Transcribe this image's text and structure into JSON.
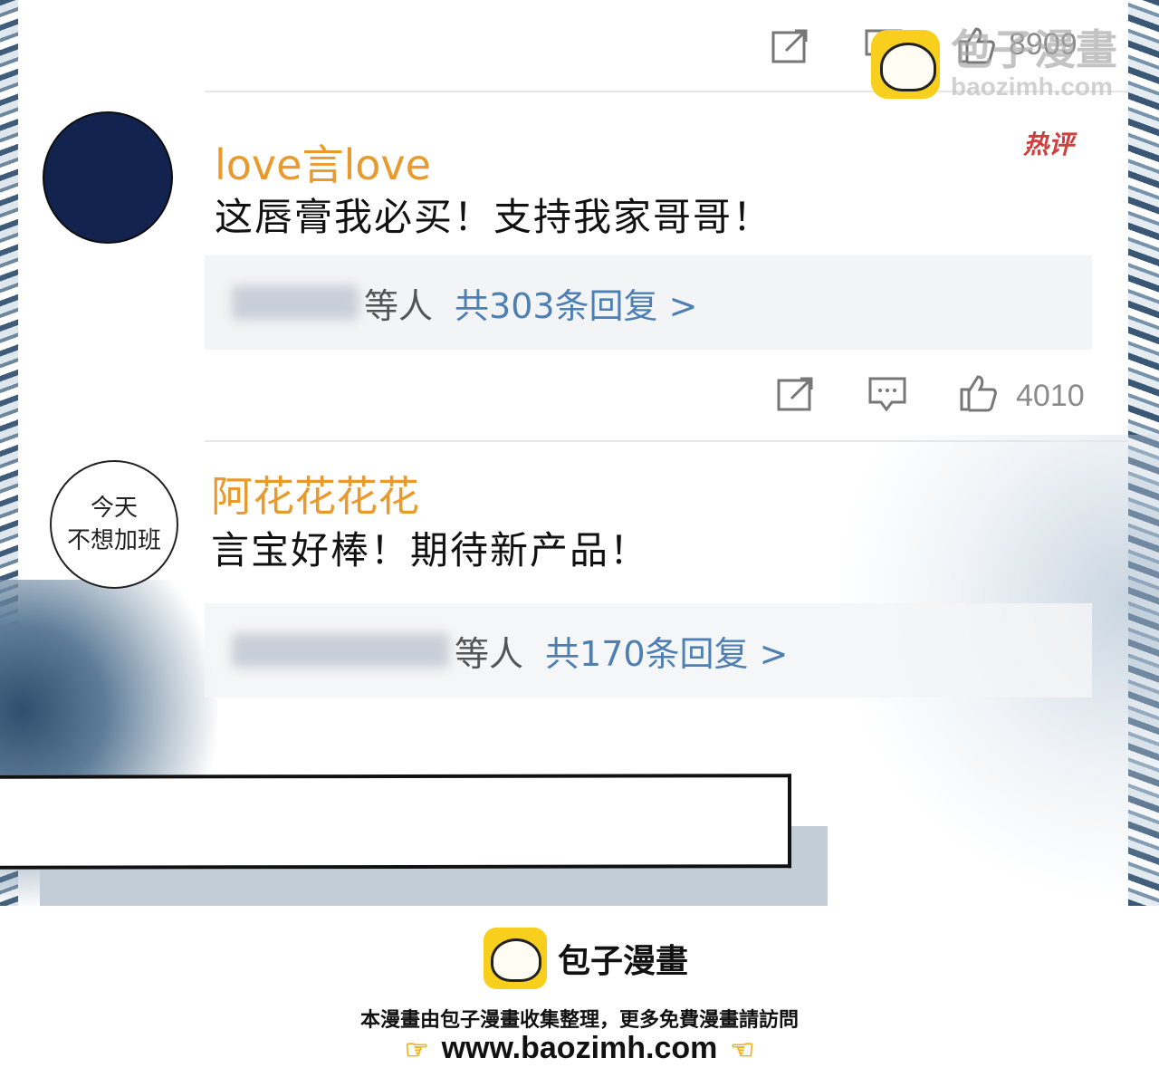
{
  "watermark": {
    "title": "包子漫畫",
    "url": "baozimh.com"
  },
  "top_post": {
    "like_count": "8909"
  },
  "comments": [
    {
      "username": "love言love",
      "text": "这唇膏我必买！支持我家哥哥！",
      "badge": "热评",
      "reply_suffix": "等人",
      "reply_count": "共303条回复 >",
      "like_count": "4010"
    },
    {
      "username": "阿花花花花",
      "avatar_text_line1": "今天",
      "avatar_text_line2": "不想加班",
      "text": "言宝好棒！期待新产品！",
      "reply_suffix": "等人",
      "reply_count": "共170条回复 >"
    }
  ],
  "footer": {
    "brand": "包子漫畫",
    "note": "本漫畫由包子漫畫收集整理，更多免費漫畫請訪問",
    "url": "www.baozimh.com"
  },
  "colors": {
    "username": "#e89a2c",
    "reply_link": "#4d7fb3",
    "avatar1": "#13234f",
    "badge": "#d33c3c"
  }
}
